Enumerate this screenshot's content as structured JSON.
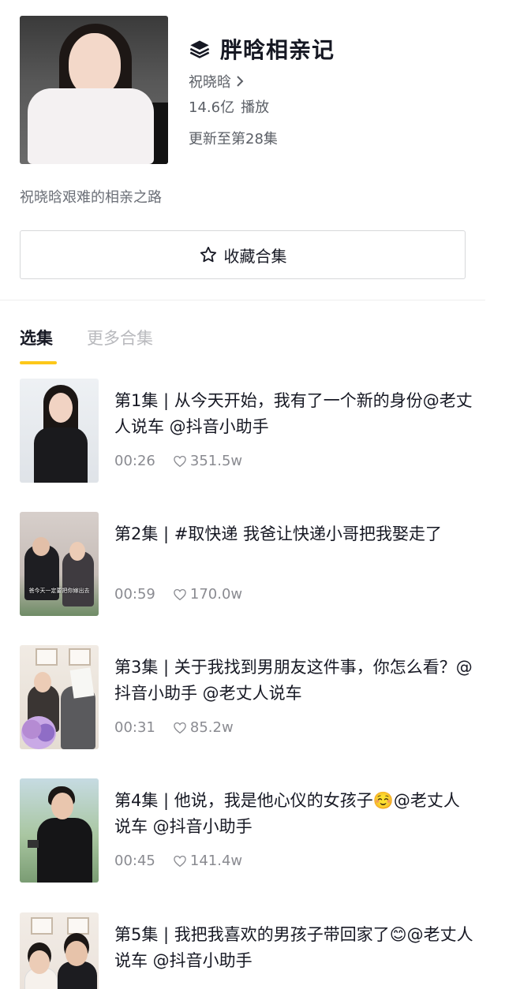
{
  "header": {
    "series_icon": "layers-icon",
    "title": "胖晗相亲记",
    "author": "祝晓晗",
    "plays": "14.6亿",
    "plays_label": "播放",
    "updated": "更新至第28集"
  },
  "description": "祝晓晗艰难的相亲之路",
  "favorite_button": {
    "label": "收藏合集",
    "icon": "star-icon"
  },
  "tabs": [
    {
      "label": "选集",
      "active": true
    },
    {
      "label": "更多合集",
      "active": false
    }
  ],
  "accent_color": "#fdc819",
  "episodes": [
    {
      "title": "第1集 | 从今天开始，我有了一个新的身份@老丈人说车 @抖音小助手",
      "duration": "00:26",
      "likes": "351.5w"
    },
    {
      "title": "第2集 | #取快递 我爸让快递小哥把我娶走了",
      "duration": "00:59",
      "likes": "170.0w",
      "thumb_caption": "爸今天一定要把你嫁出去"
    },
    {
      "title": "第3集 | 关于我找到男朋友这件事，你怎么看？@抖音小助手 @老丈人说车",
      "duration": "00:31",
      "likes": "85.2w"
    },
    {
      "title": "第4集 | 他说，我是他心仪的女孩子☺️@老丈人说车 @抖音小助手",
      "duration": "00:45",
      "likes": "141.4w"
    },
    {
      "title": "第5集 | 我把我喜欢的男孩子带回家了😊@老丈人说车 @抖音小助手",
      "duration": "",
      "likes": ""
    }
  ]
}
